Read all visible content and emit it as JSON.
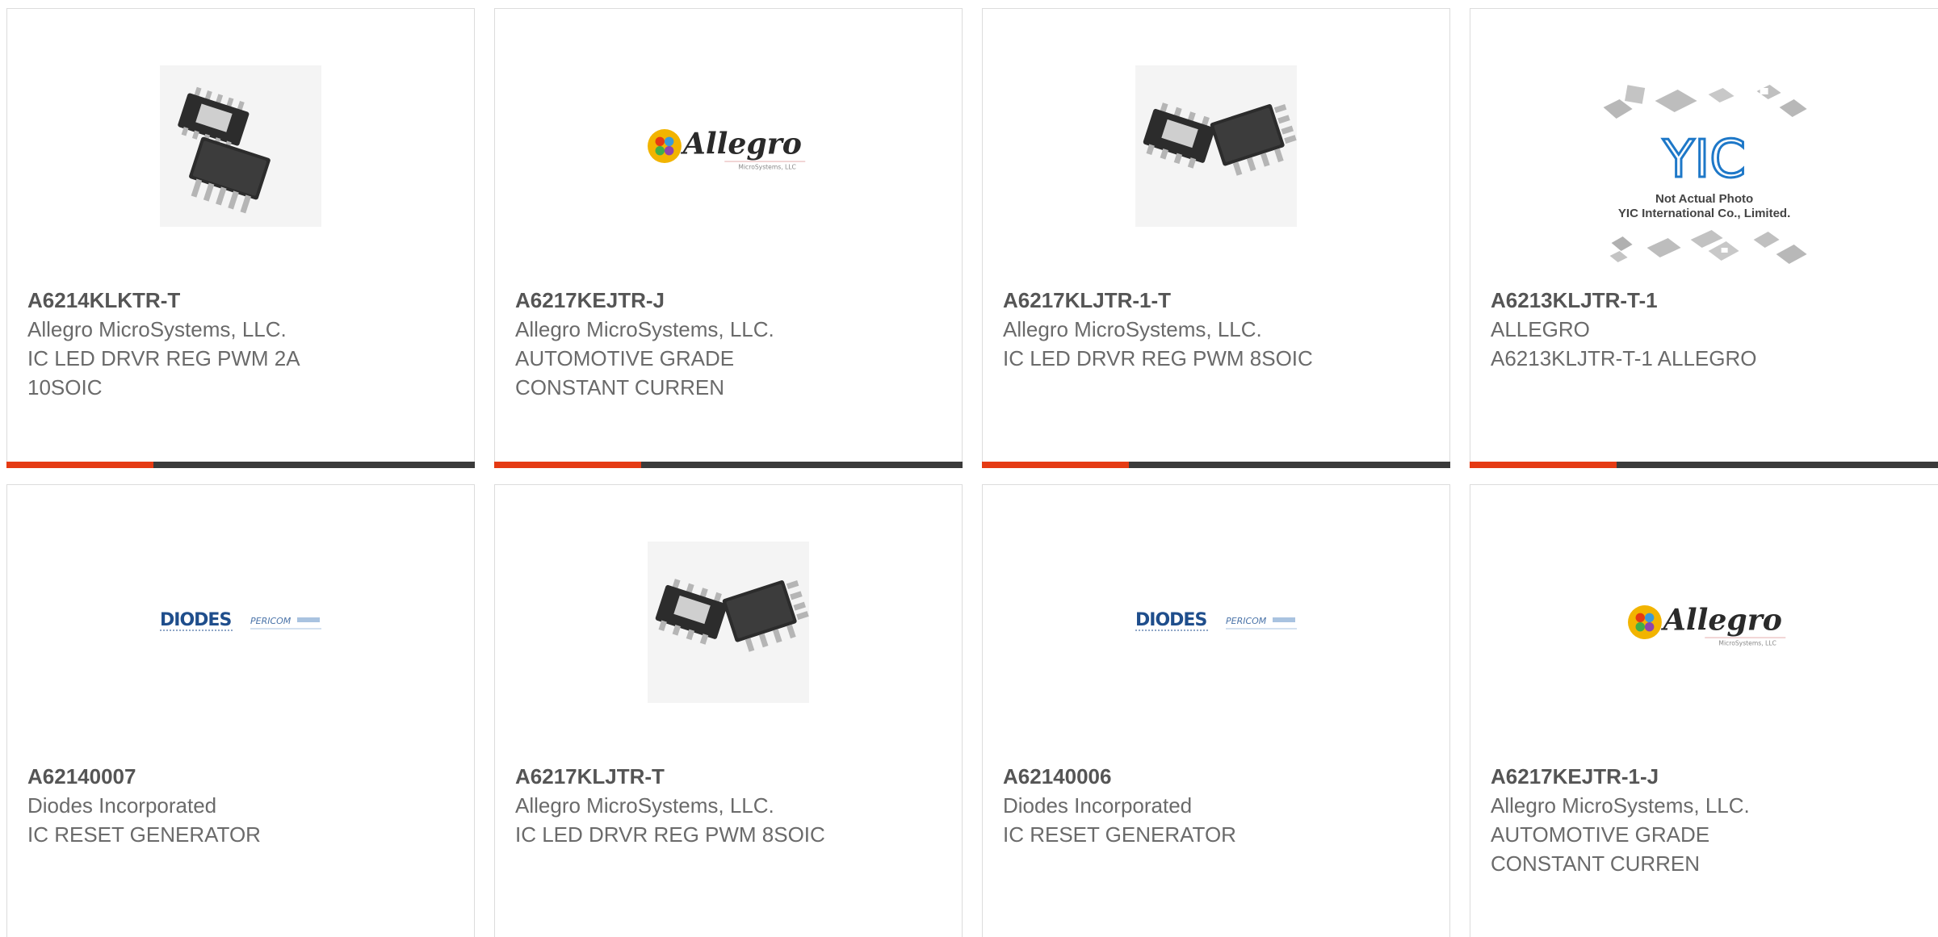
{
  "products": [
    {
      "part_number": "A6214KLKTR-T",
      "manufacturer": "Allegro MicroSystems, LLC.",
      "description_lines": [
        "IC LED DRVR REG PWM 2A",
        "10SOIC"
      ],
      "image": "chip-10soic-photo"
    },
    {
      "part_number": "A6217KEJTR-J",
      "manufacturer": "Allegro MicroSystems, LLC.",
      "description_lines": [
        "AUTOMOTIVE GRADE",
        "CONSTANT CURREN"
      ],
      "image": "allegro-logo",
      "logo_text": "Allegro",
      "logo_subtext": "MicroSystems, LLC"
    },
    {
      "part_number": "A6217KLJTR-1-T",
      "manufacturer": "Allegro MicroSystems, LLC.",
      "description_lines": [
        "IC LED DRVR REG PWM 8SOIC"
      ],
      "image": "chip-8soic-photo"
    },
    {
      "part_number": "A6213KLJTR-T-1",
      "manufacturer": "ALLEGRO",
      "description_lines": [
        "A6213KLJTR-T-1 ALLEGRO"
      ],
      "image": "yic-placeholder",
      "logo_text": "YIC",
      "placeholder_line1": "Not Actual Photo",
      "placeholder_line2": "YIC International Co., Limited."
    },
    {
      "part_number": "A62140007",
      "manufacturer": "Diodes Incorporated",
      "description_lines": [
        "IC RESET GENERATOR"
      ],
      "image": "diodes-pericom-logo",
      "logo_text": "DIODES",
      "logo_subtext": "PERICOM"
    },
    {
      "part_number": "A6217KLJTR-T",
      "manufacturer": "Allegro MicroSystems, LLC.",
      "description_lines": [
        "IC LED DRVR REG PWM 8SOIC"
      ],
      "image": "chip-8soic-photo"
    },
    {
      "part_number": "A62140006",
      "manufacturer": "Diodes Incorporated",
      "description_lines": [
        "IC RESET GENERATOR"
      ],
      "image": "diodes-pericom-logo",
      "logo_text": "DIODES",
      "logo_subtext": "PERICOM"
    },
    {
      "part_number": "A6217KEJTR-1-J",
      "manufacturer": "Allegro MicroSystems, LLC.",
      "description_lines": [
        "AUTOMOTIVE GRADE",
        "CONSTANT CURREN"
      ],
      "image": "allegro-logo",
      "logo_text": "Allegro",
      "logo_subtext": "MicroSystems, LLC"
    }
  ],
  "colors": {
    "accent": "#e53a13",
    "bar": "#3a3a3a",
    "part_number": "#555555",
    "text": "#6a6a6a",
    "border": "#dcdcdc",
    "diodes_blue": "#1f4e8c"
  }
}
